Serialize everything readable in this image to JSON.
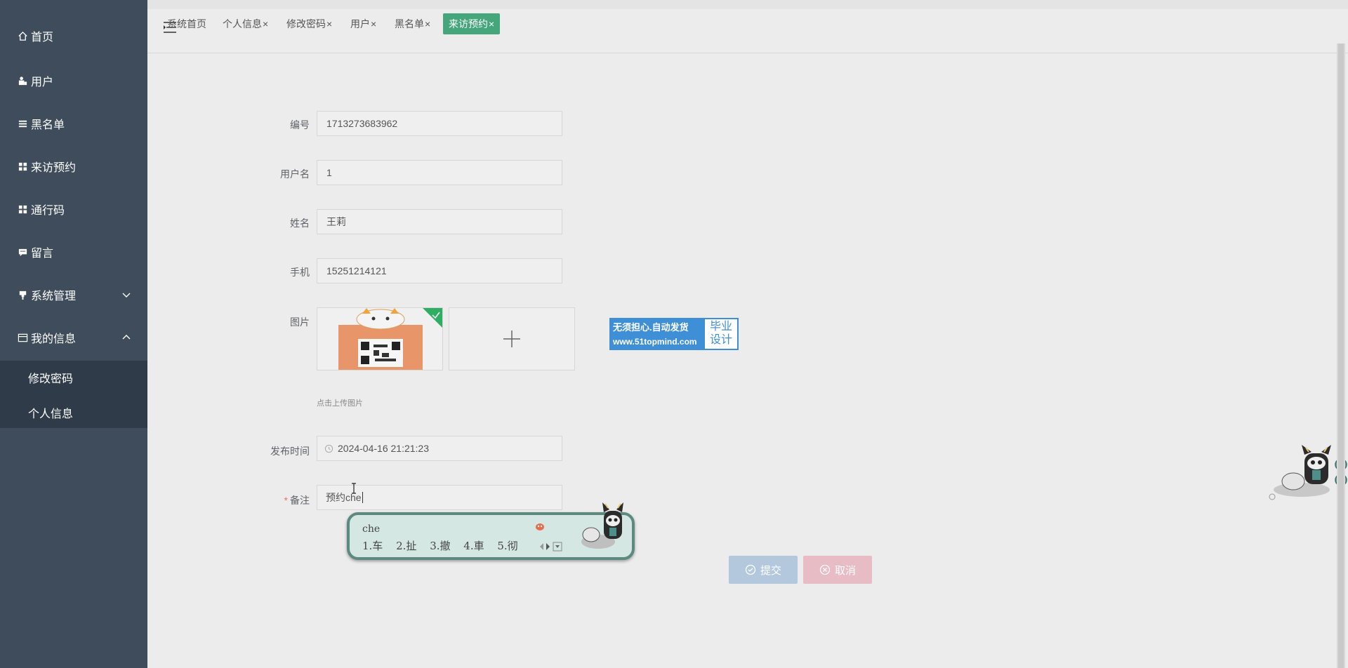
{
  "sidebar": {
    "items": [
      {
        "label": "首页",
        "icon": "home-icon"
      },
      {
        "label": "用户",
        "icon": "user-icon"
      },
      {
        "label": "黑名单",
        "icon": "list-icon"
      },
      {
        "label": "来访预约",
        "icon": "grid-icon"
      },
      {
        "label": "通行码",
        "icon": "grid-icon"
      },
      {
        "label": "留言",
        "icon": "message-icon"
      },
      {
        "label": "系统管理",
        "icon": "pin-icon"
      },
      {
        "label": "我的信息",
        "icon": "card-icon"
      }
    ],
    "submenu": [
      {
        "label": "修改密码"
      },
      {
        "label": "个人信息"
      }
    ]
  },
  "tabs": {
    "items": [
      {
        "label": "系统首页"
      },
      {
        "label": "个人信息"
      },
      {
        "label": "修改密码"
      },
      {
        "label": "用户"
      },
      {
        "label": "黑名单"
      },
      {
        "label": "来访预约"
      }
    ],
    "close_glyph": "×"
  },
  "form": {
    "labels": {
      "number": "编号",
      "username": "用户名",
      "name": "姓名",
      "phone": "手机",
      "image": "图片",
      "publish_time": "发布时间",
      "remark": "备注"
    },
    "required_mark": "*",
    "values": {
      "number": "1713273683962",
      "username": "1",
      "name": "王莉",
      "phone": "15251214121",
      "publish_time": "2024-04-16 21:21:23",
      "remark": "预约che"
    },
    "upload_hint": "点击上传图片",
    "upload_plus": "+"
  },
  "watermark": {
    "line1": "无须担心.自动发货",
    "url": "www.51topmind.com",
    "right_line1": "毕业",
    "right_line2": "设计"
  },
  "buttons": {
    "submit": "提交",
    "cancel": "取消"
  },
  "ime": {
    "composition": "che",
    "candidates": [
      "1.车",
      "2.扯",
      "3.撤",
      "4.車",
      "5.彻"
    ]
  },
  "colors": {
    "sidebar_bg": "#3e4c5b",
    "submenu_bg": "#2f3b48",
    "active_tab": "#45a57b",
    "submit_btn": "#b3c8dd",
    "cancel_btn": "#e8bcc4",
    "watermark": "#3e8fd6"
  }
}
